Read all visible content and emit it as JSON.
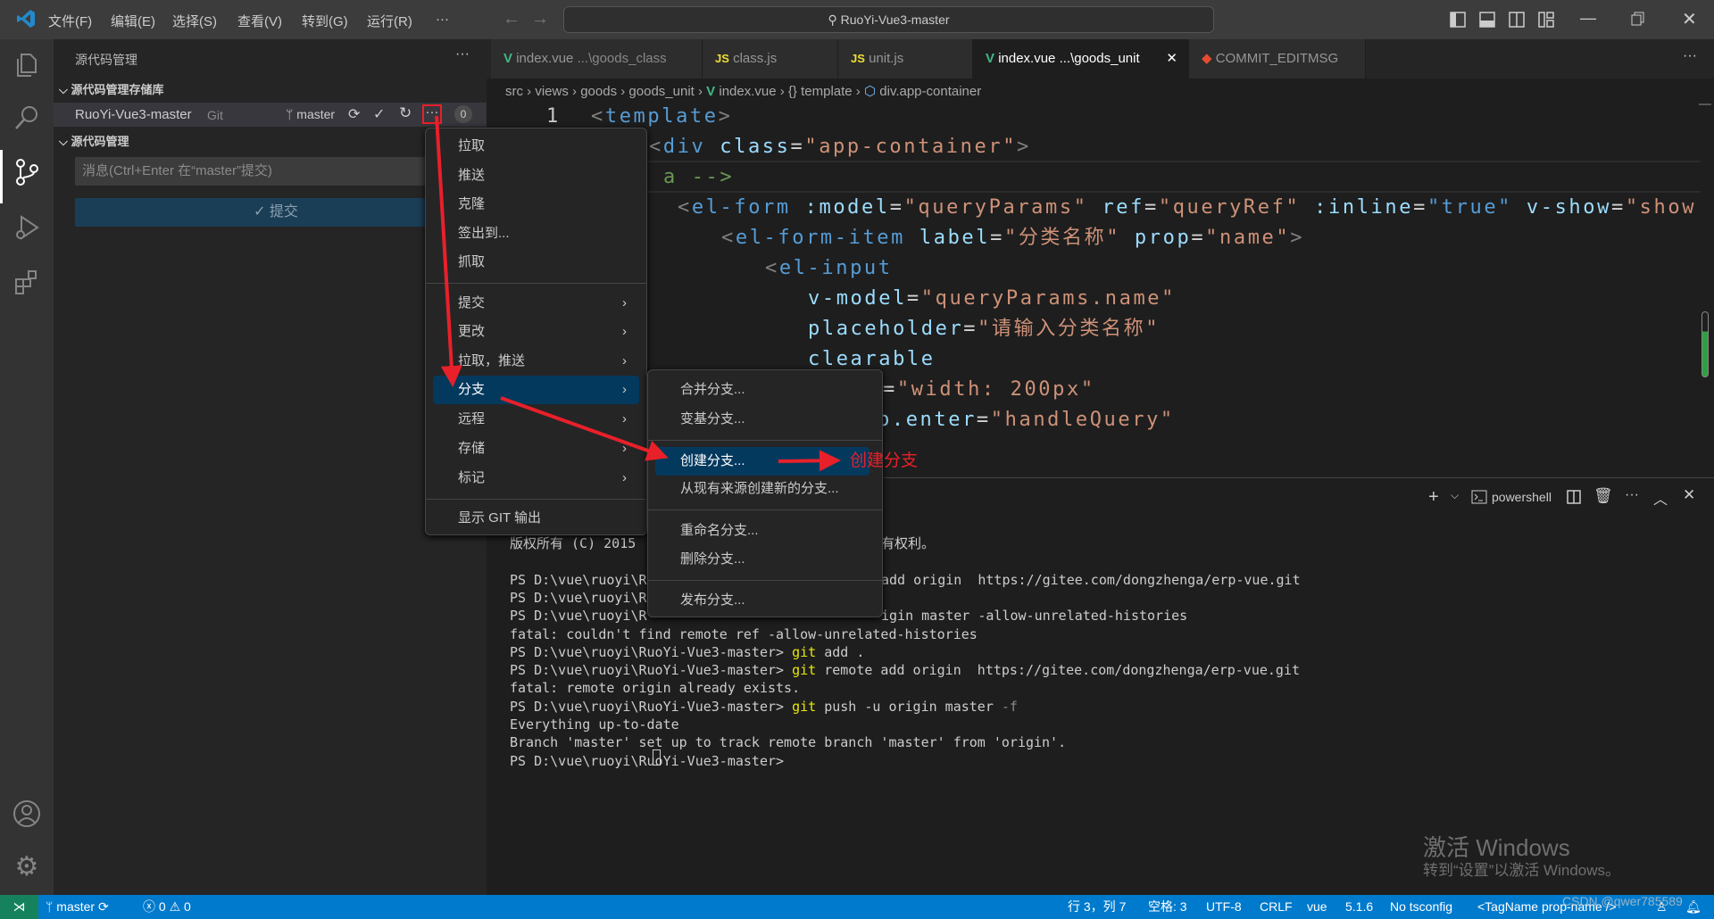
{
  "titlebar": {
    "menus": [
      "文件(F)",
      "编辑(E)",
      "选择(S)",
      "查看(V)",
      "转到(G)",
      "运行(R)",
      "···"
    ],
    "search": "RuoYi-Vue3-master"
  },
  "sidebar": {
    "title": "源代码管理",
    "more": "···",
    "repos_section": "源代码管理存储库",
    "repo_name": "RuoYi-Vue3-master",
    "repo_type": "Git",
    "branch": "master",
    "badge": "0",
    "changes_section": "源代码管理",
    "message_placeholder": "消息(Ctrl+Enter 在“master”提交)",
    "commit_label": "✓ 提交"
  },
  "tabs": [
    {
      "icon": "V",
      "name": "index.vue",
      "desc": "...\\goods_class"
    },
    {
      "icon": "JS",
      "name": "class.js",
      "desc": ""
    },
    {
      "icon": "JS",
      "name": "unit.js",
      "desc": ""
    },
    {
      "icon": "V",
      "name": "index.vue",
      "desc": "...\\goods_unit",
      "active": true
    },
    {
      "icon": "git",
      "name": "COMMIT_EDITMSG",
      "desc": ""
    }
  ],
  "breadcrumb": [
    "src",
    "views",
    "goods",
    "goods_unit",
    "index.vue",
    "{} template",
    "div.app-container"
  ],
  "editor": {
    "line_number": "1",
    "lines": [
      [
        [
          "<",
          "br"
        ],
        [
          "template",
          "tag"
        ],
        [
          ">",
          "br"
        ]
      ],
      [
        [
          "<",
          "br"
        ],
        [
          "div",
          "tag"
        ],
        [
          " ",
          "pl"
        ],
        [
          "class",
          "at"
        ],
        [
          "=",
          "pl"
        ],
        [
          "\"app-container\"",
          "st"
        ],
        [
          ">",
          "br"
        ]
      ],
      [
        [
          "a ",
          "cm"
        ],
        [
          "-->",
          "cm"
        ]
      ],
      [
        [
          "<",
          "br"
        ],
        [
          "el-form",
          "tag"
        ],
        [
          " ",
          "pl"
        ],
        [
          ":model",
          "at"
        ],
        [
          "=",
          "pl"
        ],
        [
          "\"queryParams\"",
          "st"
        ],
        [
          " ",
          "pl"
        ],
        [
          "ref",
          "at"
        ],
        [
          "=",
          "pl"
        ],
        [
          "\"queryRef\"",
          "st"
        ],
        [
          " ",
          "pl"
        ],
        [
          ":inline",
          "at"
        ],
        [
          "=",
          "pl"
        ],
        [
          "\"true\"",
          "tag"
        ],
        [
          " ",
          "pl"
        ],
        [
          "v-show",
          "at"
        ],
        [
          "=",
          "pl"
        ],
        [
          "\"show",
          "st"
        ]
      ],
      [
        [
          "<",
          "br"
        ],
        [
          "el-form-item",
          "tag"
        ],
        [
          " ",
          "pl"
        ],
        [
          "label",
          "at"
        ],
        [
          "=",
          "pl"
        ],
        [
          "\"分类名称\"",
          "st"
        ],
        [
          " ",
          "pl"
        ],
        [
          "prop",
          "at"
        ],
        [
          "=",
          "pl"
        ],
        [
          "\"name\"",
          "st"
        ],
        [
          ">",
          "br"
        ]
      ],
      [
        [
          "<",
          "br"
        ],
        [
          "el-input",
          "tag"
        ]
      ],
      [
        [
          "v-model",
          "at"
        ],
        [
          "=",
          "pl"
        ],
        [
          "\"queryParams.name\"",
          "st"
        ]
      ],
      [
        [
          "placeholder",
          "at"
        ],
        [
          "=",
          "pl"
        ],
        [
          "\"请输入分类名称\"",
          "st"
        ]
      ],
      [
        [
          "clearable",
          "at"
        ]
      ],
      [
        [
          "=",
          "pl"
        ],
        [
          "\"width: 200px\"",
          "st"
        ]
      ],
      [
        [
          "p.enter",
          "at"
        ],
        [
          "=",
          "pl"
        ],
        [
          "\"handleQuery\"",
          "st"
        ]
      ]
    ]
  },
  "context_menu": {
    "items": [
      "拉取",
      "推送",
      "克隆",
      "签出到...",
      "抓取",
      "提交",
      "更改",
      "拉取，推送",
      "分支",
      "远程",
      "存储",
      "标记",
      "显示 GIT 输出"
    ],
    "submenu_arrow": "›"
  },
  "branch_submenu": {
    "items": [
      "合并分支...",
      "变基分支...",
      "创建分支...",
      "从现有来源创建新的分支...",
      "重命名分支...",
      "删除分支...",
      "发布分支..."
    ]
  },
  "annotation": {
    "label": "创建分支",
    "color": "#e8202a"
  },
  "panel": {
    "shell": "powershell"
  },
  "terminal": {
    "lines": [
      [
        [
          "版权所有 (C) 2015",
          ""
        ]
      ],
      [],
      [
        [
          "PS D:\\vue\\ruoyi\\R",
          ""
        ]
      ],
      [
        [
          "PS D:\\vue\\ruoyi\\R",
          ""
        ]
      ],
      [
        [
          "PS D:\\vue\\ruoyi\\R",
          ""
        ]
      ],
      [
        [
          "fatal: couldn't find remote ref -allow-unrelated-histories",
          ""
        ]
      ],
      [
        [
          "PS D:\\vue\\ruoyi\\RuoYi-Vue3-master> ",
          ""
        ],
        [
          "git",
          "y"
        ],
        [
          " add .",
          ""
        ]
      ],
      [
        [
          "PS D:\\vue\\ruoyi\\RuoYi-Vue3-master> ",
          ""
        ],
        [
          "git",
          "y"
        ],
        [
          " remote add origin  https://gitee.com/dongzhenga/erp-vue.git",
          ""
        ]
      ],
      [
        [
          "fatal: remote origin already exists.",
          ""
        ]
      ],
      [
        [
          "PS D:\\vue\\ruoyi\\RuoYi-Vue3-master> ",
          ""
        ],
        [
          "git",
          "y"
        ],
        [
          " push ",
          ""
        ],
        [
          "-u",
          ""
        ],
        [
          " origin master ",
          ""
        ],
        [
          "-f",
          "g"
        ]
      ],
      [
        [
          "Everything up-to-date",
          ""
        ]
      ],
      [
        [
          "Branch 'master' set up to track remote branch 'master' from 'origin'.",
          ""
        ]
      ],
      [
        [
          "PS D:\\vue\\ruoyi\\RuoYi-Vue3-master> ",
          ""
        ]
      ]
    ],
    "right_fragments": [
      "有权利。",
      "add origin  https://gitee.com/dongzhenga/erp-vue.git",
      "",
      "igin master -allow-unrelated-histories"
    ]
  },
  "watermark": {
    "line1": "激活 Windows",
    "line2": "转到“设置”以激活 Windows。",
    "csdn": "CSDN @qwer785589"
  },
  "statusbar": {
    "branch": "master",
    "errors": "0",
    "warnings": "0",
    "position": "行 3，列 7",
    "spaces": "空格: 3",
    "encoding": "UTF-8",
    "eol": "CRLF",
    "language": "vue",
    "version": "5.1.6",
    "tsconfig": "No tsconfig",
    "tagname": "<TagName prop-name />"
  },
  "colors": {
    "accent": "#007acc",
    "highlight": "#04395e",
    "remote": "#16825d",
    "arrow": "#e8202a"
  }
}
